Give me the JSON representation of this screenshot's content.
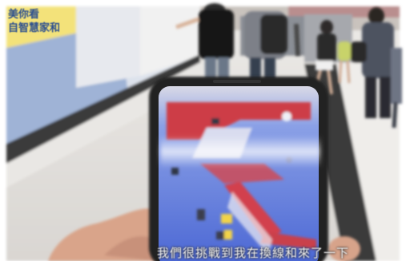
{
  "scene": {
    "ad_banner": {
      "line1": "美你看",
      "line2": "自智慧家和"
    },
    "subtitle": "我們很挑戰到我在換線和來了一下"
  },
  "colors": {
    "background": "#ffffff",
    "wall_panel": "#dfe3ea",
    "floor": "#f2f0ee",
    "phone_frame": "#242424",
    "game_water": "#4d6ad8",
    "game_red": "#cf3d4a",
    "subtitle_text": "#f4f4f4"
  },
  "icons": [
    "phone",
    "hand",
    "people",
    "game-board"
  ]
}
